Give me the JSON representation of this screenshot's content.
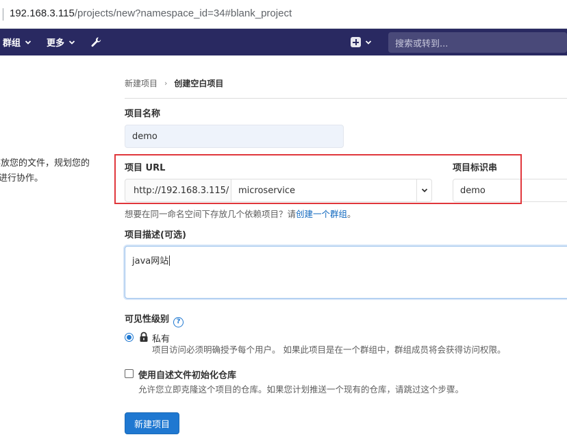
{
  "browser": {
    "url_host": "192.168.3.115",
    "url_path": "/projects/new?namespace_id=34#blank_project"
  },
  "navbar": {
    "groups_label": "群组",
    "more_label": "更多",
    "search_placeholder": "搜索或转到...",
    "background_color": "#292961"
  },
  "sidebar": {
    "description_line1": "存放您的文件，规划您的",
    "description_line2": "或进行协作。"
  },
  "breadcrumb": {
    "parent": "新建项目",
    "current": "创建空白项目"
  },
  "form": {
    "name_label": "项目名称",
    "name_value": "demo",
    "url_label": "项目 URL",
    "url_prefix": "http://192.168.3.115/",
    "namespace_value": "microservice",
    "slug_label": "项目标识串",
    "slug_value": "demo",
    "hint_text": "想要在同一命名空间下存放几个依赖项目？请",
    "hint_link": "创建一个群组",
    "hint_end": "。",
    "description_label": "项目描述(可选)",
    "description_value": "java网站",
    "visibility_label": "可见性级别",
    "visibility_help": "?",
    "private_label": "私有",
    "private_description": "项目访问必须明确授予每个用户。 如果此项目是在一个群组中，群组成员将会获得访问权限。",
    "init_label": "使用自述文件初始化仓库",
    "init_description": "允许您立即克隆这个项目的仓库。如果您计划推送一个现有的仓库，请跳过这个步骤。",
    "init_checked": false,
    "visibility_selected": "private",
    "submit_label": "新建项目"
  },
  "colors": {
    "primary": "#1f78d1",
    "highlight_border": "#e0363b"
  }
}
